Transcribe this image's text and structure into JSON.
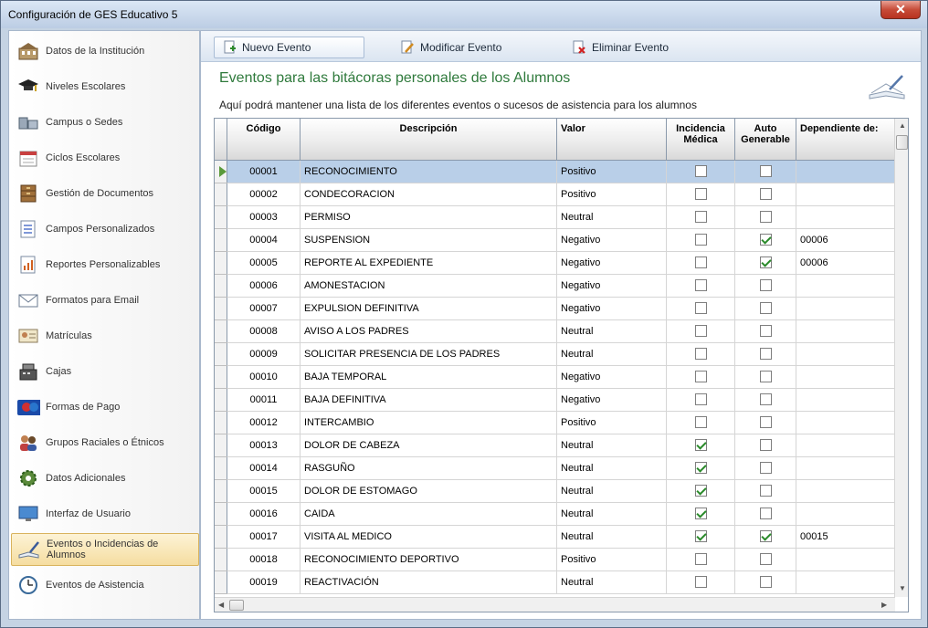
{
  "window": {
    "title": "Configuración de GES Educativo 5",
    "close_label": "✕"
  },
  "sidebar": {
    "items": [
      {
        "label": "Datos de la Institución",
        "icon": "building-icon"
      },
      {
        "label": "Niveles Escolares",
        "icon": "graduation-cap-icon"
      },
      {
        "label": "Campus o Sedes",
        "icon": "campus-icon"
      },
      {
        "label": "Ciclos Escolares",
        "icon": "calendar-icon"
      },
      {
        "label": "Gestión de Documentos",
        "icon": "cabinet-icon"
      },
      {
        "label": "Campos Personalizados",
        "icon": "checklist-icon"
      },
      {
        "label": "Reportes Personalizables",
        "icon": "report-icon"
      },
      {
        "label": "Formatos para Email",
        "icon": "email-icon"
      },
      {
        "label": "Matrículas",
        "icon": "id-card-icon"
      },
      {
        "label": "Cajas",
        "icon": "cash-register-icon"
      },
      {
        "label": "Formas de Pago",
        "icon": "credit-card-icon"
      },
      {
        "label": "Grupos Raciales o Étnicos",
        "icon": "people-icon"
      },
      {
        "label": "Datos Adicionales",
        "icon": "gear-icon"
      },
      {
        "label": "Interfaz de Usuario",
        "icon": "monitor-icon"
      },
      {
        "label": "Eventos o Incidencias de Alumnos",
        "icon": "book-pen-icon",
        "active": true
      },
      {
        "label": "Eventos de Asistencia",
        "icon": "clock-icon"
      }
    ]
  },
  "toolbar": {
    "new_label": "Nuevo Evento",
    "edit_label": "Modificar Evento",
    "delete_label": "Eliminar Evento"
  },
  "main": {
    "title": "Eventos para las bitácoras personales de los Alumnos",
    "subtitle": "Aquí podrá mantener una lista de los diferentes eventos o sucesos de asistencia para los alumnos"
  },
  "table": {
    "headers": {
      "code": "Código",
      "description": "Descripción",
      "value": "Valor",
      "medical_1": "Incidencia",
      "medical_2": "Médica",
      "auto_1": "Auto",
      "auto_2": "Generable",
      "dependent": "Dependiente de:"
    },
    "rows": [
      {
        "code": "00001",
        "description": "RECONOCIMIENTO",
        "value": "Positivo",
        "medical": false,
        "auto": false,
        "dependent": "",
        "current": true
      },
      {
        "code": "00002",
        "description": "CONDECORACION",
        "value": "Positivo",
        "medical": false,
        "auto": false,
        "dependent": ""
      },
      {
        "code": "00003",
        "description": "PERMISO",
        "value": "Neutral",
        "medical": false,
        "auto": false,
        "dependent": ""
      },
      {
        "code": "00004",
        "description": "SUSPENSION",
        "value": "Negativo",
        "medical": false,
        "auto": true,
        "dependent": "00006"
      },
      {
        "code": "00005",
        "description": "REPORTE AL EXPEDIENTE",
        "value": "Negativo",
        "medical": false,
        "auto": true,
        "dependent": "00006"
      },
      {
        "code": "00006",
        "description": "AMONESTACION",
        "value": "Negativo",
        "medical": false,
        "auto": false,
        "dependent": ""
      },
      {
        "code": "00007",
        "description": "EXPULSION DEFINITIVA",
        "value": "Negativo",
        "medical": false,
        "auto": false,
        "dependent": ""
      },
      {
        "code": "00008",
        "description": "AVISO A LOS PADRES",
        "value": "Neutral",
        "medical": false,
        "auto": false,
        "dependent": ""
      },
      {
        "code": "00009",
        "description": "SOLICITAR PRESENCIA DE LOS PADRES",
        "value": "Neutral",
        "medical": false,
        "auto": false,
        "dependent": ""
      },
      {
        "code": "00010",
        "description": "BAJA TEMPORAL",
        "value": "Negativo",
        "medical": false,
        "auto": false,
        "dependent": ""
      },
      {
        "code": "00011",
        "description": "BAJA DEFINITIVA",
        "value": "Negativo",
        "medical": false,
        "auto": false,
        "dependent": ""
      },
      {
        "code": "00012",
        "description": "INTERCAMBIO",
        "value": "Positivo",
        "medical": false,
        "auto": false,
        "dependent": ""
      },
      {
        "code": "00013",
        "description": "DOLOR DE CABEZA",
        "value": "Neutral",
        "medical": true,
        "auto": false,
        "dependent": ""
      },
      {
        "code": "00014",
        "description": "RASGUÑO",
        "value": "Neutral",
        "medical": true,
        "auto": false,
        "dependent": ""
      },
      {
        "code": "00015",
        "description": "DOLOR DE ESTOMAGO",
        "value": "Neutral",
        "medical": true,
        "auto": false,
        "dependent": ""
      },
      {
        "code": "00016",
        "description": "CAIDA",
        "value": "Neutral",
        "medical": true,
        "auto": false,
        "dependent": ""
      },
      {
        "code": "00017",
        "description": "VISITA AL MEDICO",
        "value": "Neutral",
        "medical": true,
        "auto": true,
        "dependent": "00015"
      },
      {
        "code": "00018",
        "description": "RECONOCIMIENTO DEPORTIVO",
        "value": "Positivo",
        "medical": false,
        "auto": false,
        "dependent": ""
      },
      {
        "code": "00019",
        "description": "REACTIVACIÓN",
        "value": "Neutral",
        "medical": false,
        "auto": false,
        "dependent": ""
      }
    ]
  }
}
